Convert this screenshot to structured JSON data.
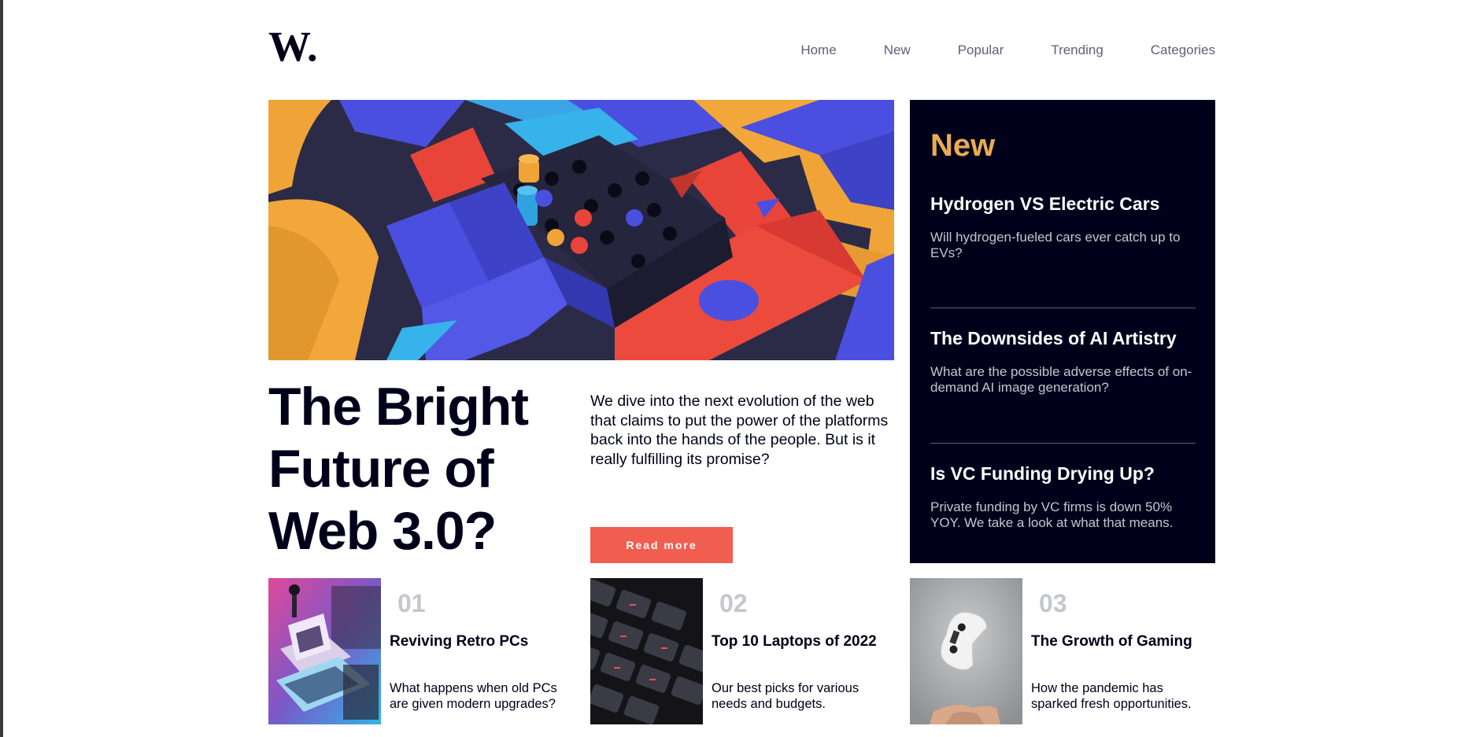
{
  "logo": {
    "text": "W."
  },
  "nav": {
    "items": [
      "Home",
      "New",
      "Popular",
      "Trending",
      "Categories"
    ]
  },
  "hero": {
    "title": "The Bright Future of Web 3.0?",
    "description": "We dive into the next evolution of the web that claims to put the power of the platforms back into the hands of the people. But is it really fulfilling its promise?",
    "button": "Read more"
  },
  "new_panel": {
    "heading": "New",
    "items": [
      {
        "title": "Hydrogen VS Electric Cars",
        "description": "Will hydrogen-fueled cars ever catch up to EVs?"
      },
      {
        "title": "The Downsides of AI Artistry",
        "description": "What are the possible adverse effects of on-demand AI image generation?"
      },
      {
        "title": "Is VC Funding Drying Up?",
        "description": "Private funding by VC firms is down 50% YOY. We take a look at what that means."
      }
    ]
  },
  "cards": [
    {
      "number": "01",
      "title": "Reviving Retro PCs",
      "description": "What happens when old PCs are given modern upgrades?"
    },
    {
      "number": "02",
      "title": "Top 10 Laptops of 2022",
      "description": "Our best picks for various needs and budgets."
    },
    {
      "number": "03",
      "title": "The Growth of Gaming",
      "description": "How the pandemic has sparked fresh opportunities."
    }
  ],
  "colors": {
    "accent_orange": "#e9ab53",
    "button_red": "#f15e50",
    "dark_navy": "#00001a",
    "muted_gray": "#c5c6ce",
    "nav_gray": "#5d5f79"
  }
}
